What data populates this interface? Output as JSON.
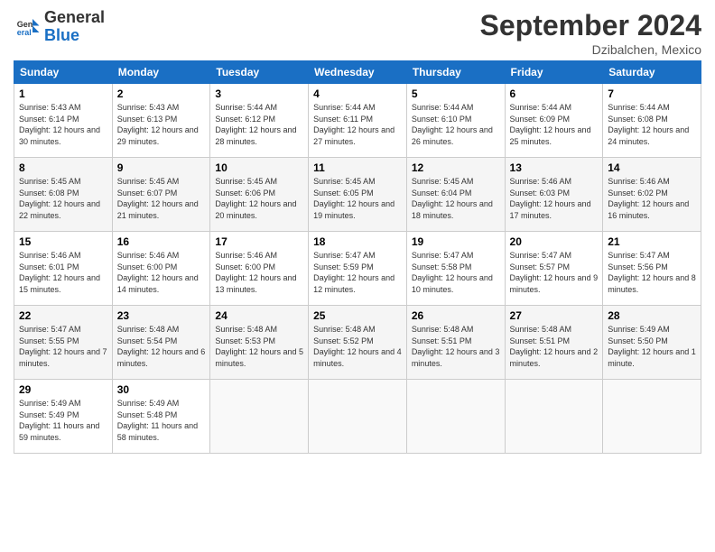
{
  "header": {
    "logo_general": "General",
    "logo_blue": "Blue",
    "month_title": "September 2024",
    "location": "Dzibalchen, Mexico"
  },
  "weekdays": [
    "Sunday",
    "Monday",
    "Tuesday",
    "Wednesday",
    "Thursday",
    "Friday",
    "Saturday"
  ],
  "weeks": [
    [
      {
        "day": "1",
        "sunrise": "5:43 AM",
        "sunset": "6:14 PM",
        "daylight": "12 hours and 30 minutes."
      },
      {
        "day": "2",
        "sunrise": "5:43 AM",
        "sunset": "6:13 PM",
        "daylight": "12 hours and 29 minutes."
      },
      {
        "day": "3",
        "sunrise": "5:44 AM",
        "sunset": "6:12 PM",
        "daylight": "12 hours and 28 minutes."
      },
      {
        "day": "4",
        "sunrise": "5:44 AM",
        "sunset": "6:11 PM",
        "daylight": "12 hours and 27 minutes."
      },
      {
        "day": "5",
        "sunrise": "5:44 AM",
        "sunset": "6:10 PM",
        "daylight": "12 hours and 26 minutes."
      },
      {
        "day": "6",
        "sunrise": "5:44 AM",
        "sunset": "6:09 PM",
        "daylight": "12 hours and 25 minutes."
      },
      {
        "day": "7",
        "sunrise": "5:44 AM",
        "sunset": "6:08 PM",
        "daylight": "12 hours and 24 minutes."
      }
    ],
    [
      {
        "day": "8",
        "sunrise": "5:45 AM",
        "sunset": "6:08 PM",
        "daylight": "12 hours and 22 minutes."
      },
      {
        "day": "9",
        "sunrise": "5:45 AM",
        "sunset": "6:07 PM",
        "daylight": "12 hours and 21 minutes."
      },
      {
        "day": "10",
        "sunrise": "5:45 AM",
        "sunset": "6:06 PM",
        "daylight": "12 hours and 20 minutes."
      },
      {
        "day": "11",
        "sunrise": "5:45 AM",
        "sunset": "6:05 PM",
        "daylight": "12 hours and 19 minutes."
      },
      {
        "day": "12",
        "sunrise": "5:45 AM",
        "sunset": "6:04 PM",
        "daylight": "12 hours and 18 minutes."
      },
      {
        "day": "13",
        "sunrise": "5:46 AM",
        "sunset": "6:03 PM",
        "daylight": "12 hours and 17 minutes."
      },
      {
        "day": "14",
        "sunrise": "5:46 AM",
        "sunset": "6:02 PM",
        "daylight": "12 hours and 16 minutes."
      }
    ],
    [
      {
        "day": "15",
        "sunrise": "5:46 AM",
        "sunset": "6:01 PM",
        "daylight": "12 hours and 15 minutes."
      },
      {
        "day": "16",
        "sunrise": "5:46 AM",
        "sunset": "6:00 PM",
        "daylight": "12 hours and 14 minutes."
      },
      {
        "day": "17",
        "sunrise": "5:46 AM",
        "sunset": "6:00 PM",
        "daylight": "12 hours and 13 minutes."
      },
      {
        "day": "18",
        "sunrise": "5:47 AM",
        "sunset": "5:59 PM",
        "daylight": "12 hours and 12 minutes."
      },
      {
        "day": "19",
        "sunrise": "5:47 AM",
        "sunset": "5:58 PM",
        "daylight": "12 hours and 10 minutes."
      },
      {
        "day": "20",
        "sunrise": "5:47 AM",
        "sunset": "5:57 PM",
        "daylight": "12 hours and 9 minutes."
      },
      {
        "day": "21",
        "sunrise": "5:47 AM",
        "sunset": "5:56 PM",
        "daylight": "12 hours and 8 minutes."
      }
    ],
    [
      {
        "day": "22",
        "sunrise": "5:47 AM",
        "sunset": "5:55 PM",
        "daylight": "12 hours and 7 minutes."
      },
      {
        "day": "23",
        "sunrise": "5:48 AM",
        "sunset": "5:54 PM",
        "daylight": "12 hours and 6 minutes."
      },
      {
        "day": "24",
        "sunrise": "5:48 AM",
        "sunset": "5:53 PM",
        "daylight": "12 hours and 5 minutes."
      },
      {
        "day": "25",
        "sunrise": "5:48 AM",
        "sunset": "5:52 PM",
        "daylight": "12 hours and 4 minutes."
      },
      {
        "day": "26",
        "sunrise": "5:48 AM",
        "sunset": "5:51 PM",
        "daylight": "12 hours and 3 minutes."
      },
      {
        "day": "27",
        "sunrise": "5:48 AM",
        "sunset": "5:51 PM",
        "daylight": "12 hours and 2 minutes."
      },
      {
        "day": "28",
        "sunrise": "5:49 AM",
        "sunset": "5:50 PM",
        "daylight": "12 hours and 1 minute."
      }
    ],
    [
      {
        "day": "29",
        "sunrise": "5:49 AM",
        "sunset": "5:49 PM",
        "daylight": "11 hours and 59 minutes."
      },
      {
        "day": "30",
        "sunrise": "5:49 AM",
        "sunset": "5:48 PM",
        "daylight": "11 hours and 58 minutes."
      },
      null,
      null,
      null,
      null,
      null
    ]
  ]
}
